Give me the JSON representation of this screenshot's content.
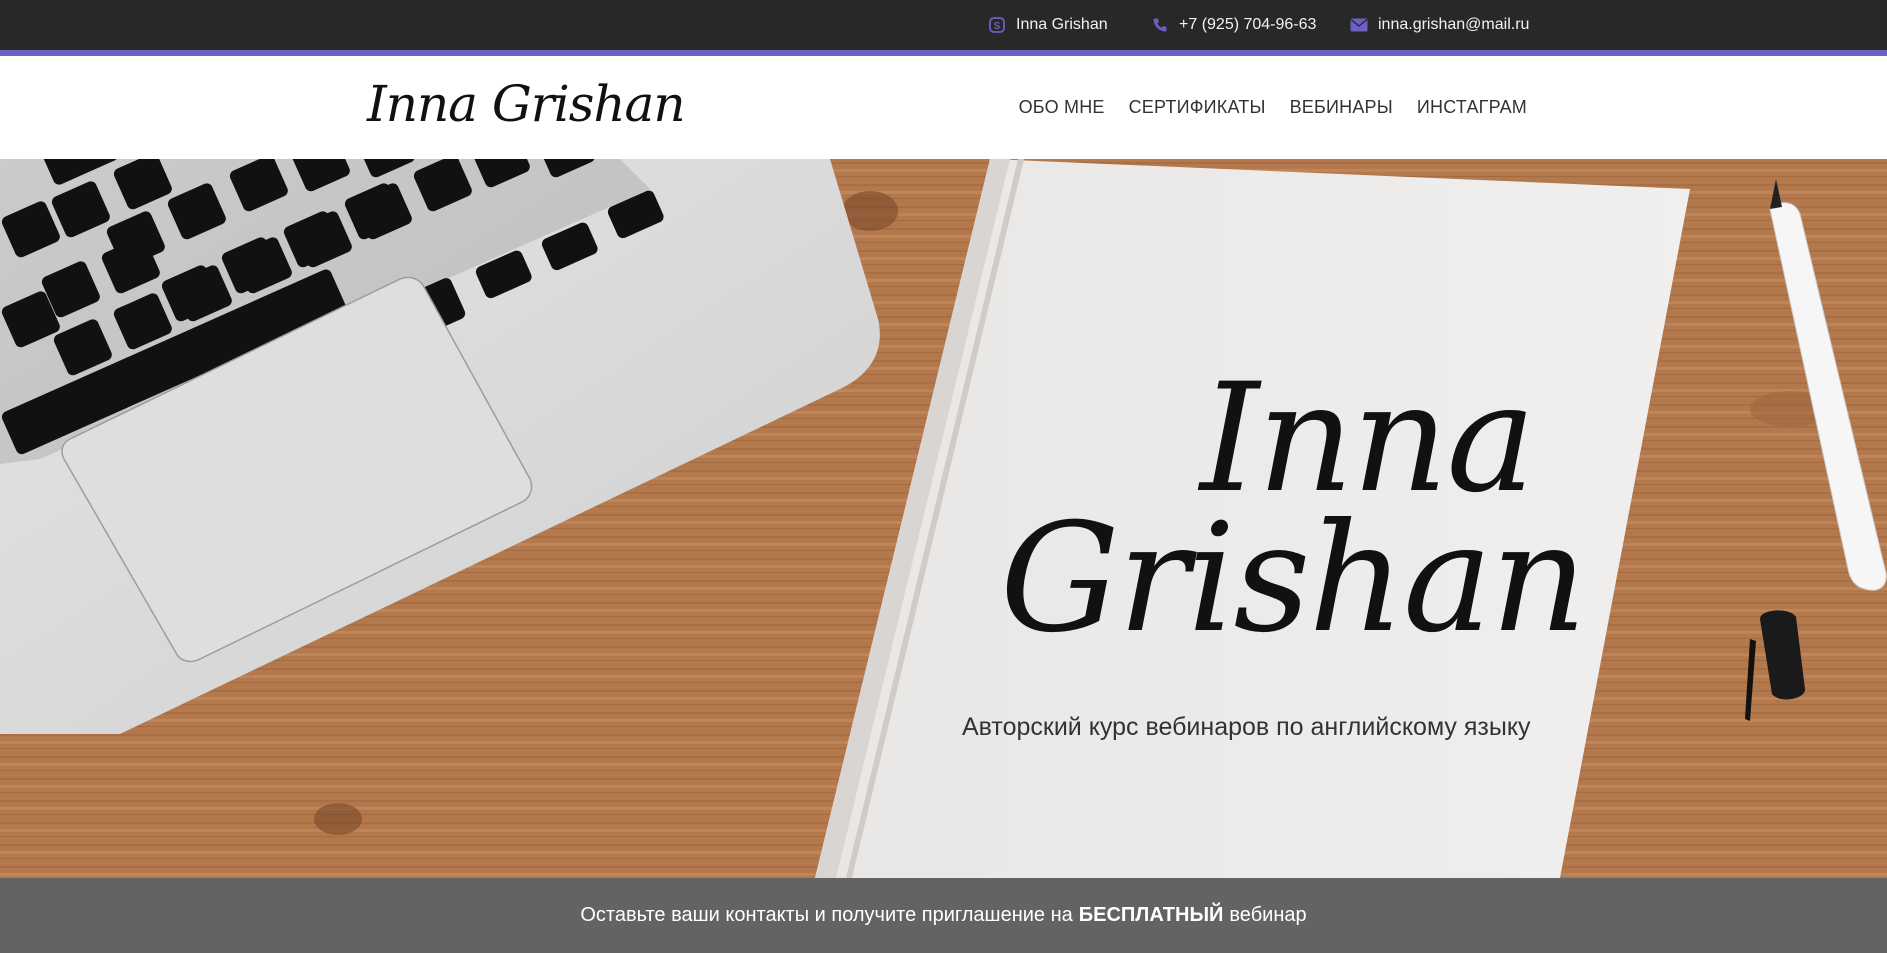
{
  "topbar": {
    "skype": {
      "icon": "skype-icon",
      "label": "Inna Grishan"
    },
    "phone": {
      "icon": "phone-icon",
      "label": "+7 (925) 704-96-63"
    },
    "email": {
      "icon": "envelope-icon",
      "label": "inna.grishan@mail.ru"
    },
    "icon_color": "#6b61c4",
    "accent_color": "#6b61c4"
  },
  "header": {
    "logo": "Inna Grishan",
    "nav": [
      "ОБО МНЕ",
      "СЕРТИФИКАТЫ",
      "ВЕБИНАРЫ",
      "ИНСТАГРАМ"
    ]
  },
  "hero": {
    "title_line1": "Inna",
    "title_line2": "Grishan",
    "subtitle": "Авторский курс вебинаров по английскому языку"
  },
  "cta": {
    "text_before": "Оставьте ваши контакты и получите приглашение на",
    "text_bold": "БЕСПЛАТНЫЙ",
    "text_after": "вебинар"
  }
}
